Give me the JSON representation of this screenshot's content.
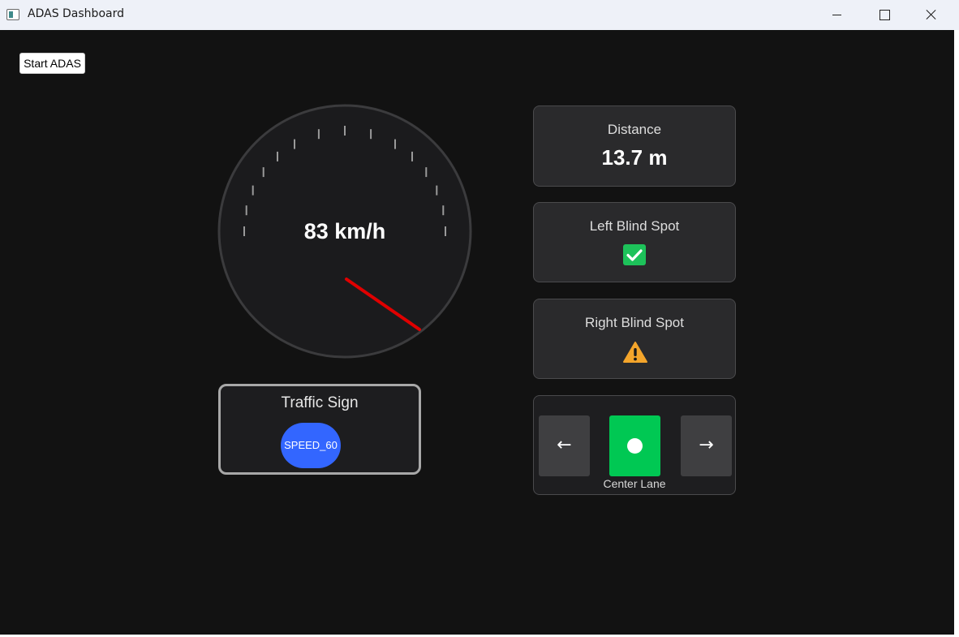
{
  "window": {
    "title": "ADAS Dashboard"
  },
  "controls": {
    "start_label": "Start ADAS"
  },
  "speedometer": {
    "speed_text": "83 km/h",
    "speed_kmh": 83,
    "needle_color": "#e00000"
  },
  "traffic_sign": {
    "title": "Traffic Sign",
    "sign": "SPEED_60",
    "badge_color": "#3366ff"
  },
  "distance": {
    "label": "Distance",
    "value": "13.7 m"
  },
  "blind_spots": {
    "left": {
      "label": "Left Blind Spot",
      "status_icon": "check-icon",
      "status_color": "#1dc25a"
    },
    "right": {
      "label": "Right Blind Spot",
      "status_icon": "warning-icon",
      "status_color": "#f4a52b"
    }
  },
  "lane": {
    "left_arrow": "←",
    "right_arrow": "→",
    "label": "Center Lane",
    "active": "center",
    "active_color": "#00c853"
  }
}
